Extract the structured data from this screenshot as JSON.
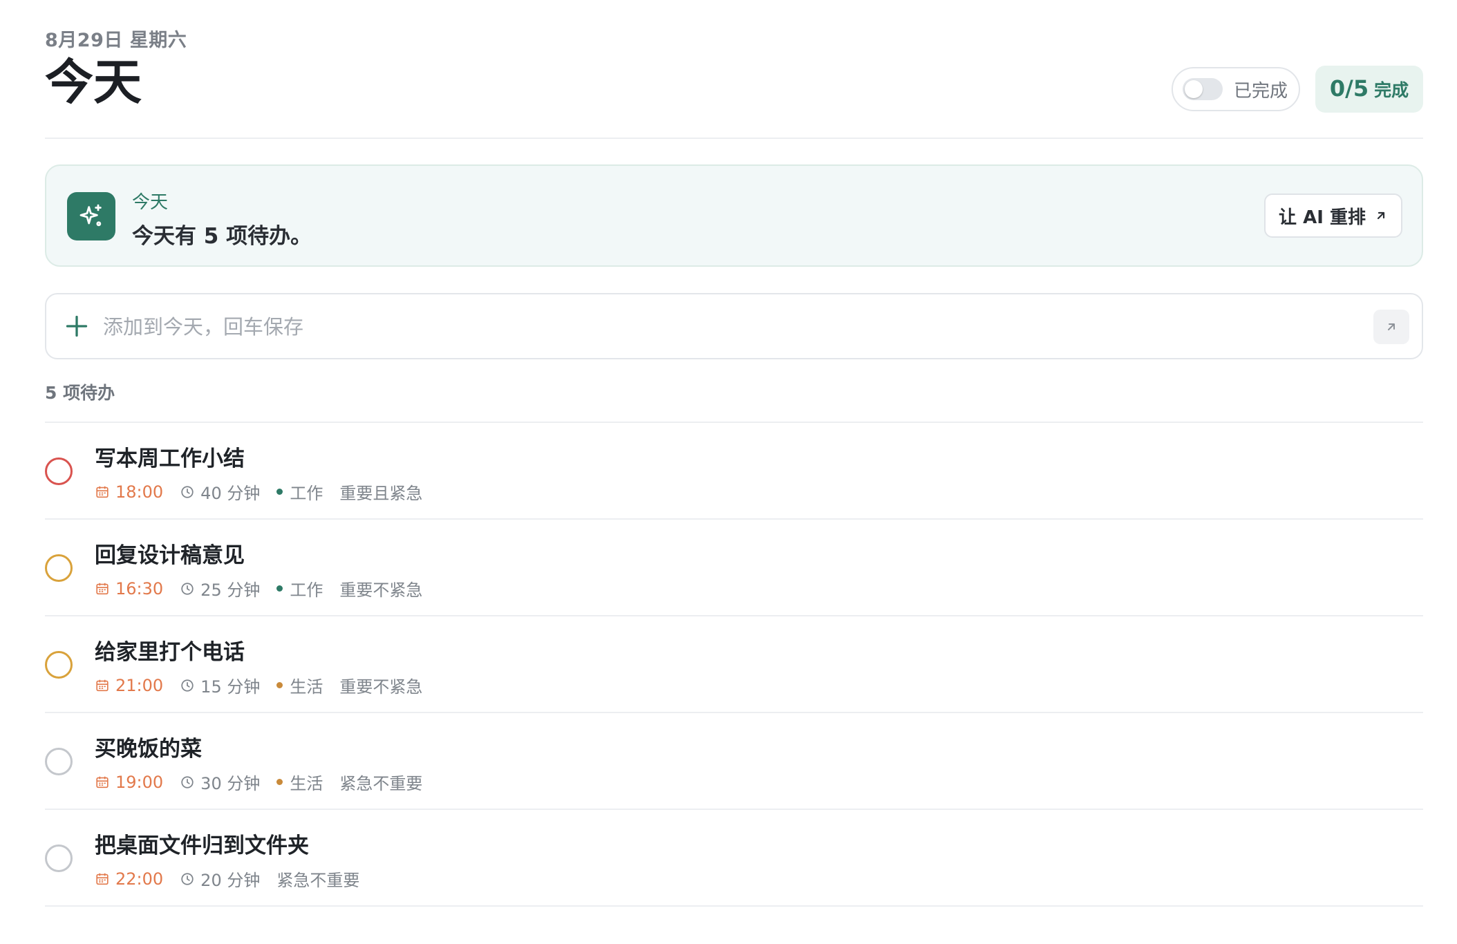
{
  "header": {
    "date": "8月29日 星期六",
    "title": "今天",
    "completed_toggle_label": "已完成",
    "progress_count": "0/5",
    "progress_suffix": "完成"
  },
  "ai_banner": {
    "label": "今天",
    "message": "今天有 5 项待办。",
    "reorder_label": "让 AI 重排",
    "icon": "sparkle-icon"
  },
  "add_task": {
    "placeholder": "添加到今天，回车保存",
    "value": ""
  },
  "list": {
    "count_label": "5 项待办"
  },
  "tasks": [
    {
      "title": "写本周工作小结",
      "time": "18:00",
      "duration": "40 分钟",
      "tag": "工作",
      "tag_color": "#2e7a66",
      "priority": "重要且紧急",
      "ring_color": "#d9534f"
    },
    {
      "title": "回复设计稿意见",
      "time": "16:30",
      "duration": "25 分钟",
      "tag": "工作",
      "tag_color": "#2e7a66",
      "priority": "重要不紧急",
      "ring_color": "#d9a23b"
    },
    {
      "title": "给家里打个电话",
      "time": "21:00",
      "duration": "15 分钟",
      "tag": "生活",
      "tag_color": "#c98a3a",
      "priority": "重要不紧急",
      "ring_color": "#d9a23b"
    },
    {
      "title": "买晚饭的菜",
      "time": "19:00",
      "duration": "30 分钟",
      "tag": "生活",
      "tag_color": "#c98a3a",
      "priority": "紧急不重要",
      "ring_color": "#c4c7cc"
    },
    {
      "title": "把桌面文件归到文件夹",
      "time": "22:00",
      "duration": "20 分钟",
      "tag": "",
      "tag_color": "",
      "priority": "紧急不重要",
      "ring_color": "#c4c7cc"
    }
  ],
  "colors": {
    "accent": "#2e7a66",
    "time_orange": "#e2794b"
  }
}
